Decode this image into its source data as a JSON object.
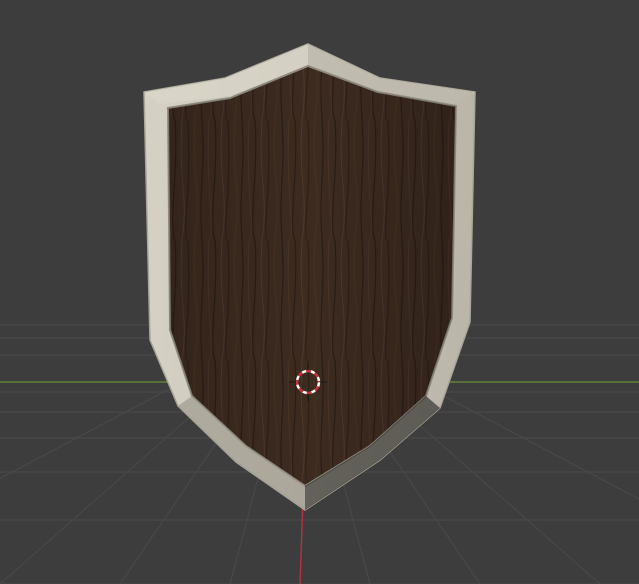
{
  "viewport": {
    "background": "#3d3d3d",
    "grid_color": "#4a4a4a",
    "x_axis_color": "#6b8f3a",
    "y_axis_color": "#b3343f"
  },
  "scene": {
    "object": "shield",
    "rim_color": "#c9c6bb",
    "wood_color": "#3b2a1f",
    "cursor": "3d-cursor-icon"
  }
}
